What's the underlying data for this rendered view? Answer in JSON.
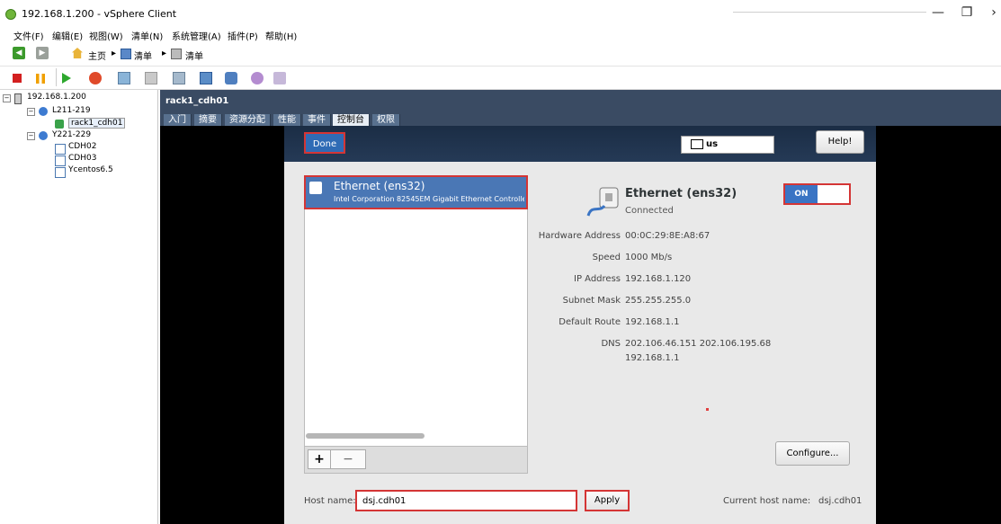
{
  "window": {
    "title": "192.168.1.200 - vSphere Client",
    "controls": {
      "minimize": "—",
      "restore": "❐",
      "more": "›"
    }
  },
  "menu": [
    "文件(F)",
    "编辑(E)",
    "视图(W)",
    "清单(N)",
    "系统管理(A)",
    "插件(P)",
    "帮助(H)"
  ],
  "nav": {
    "home": "主页",
    "inventory1": "清单",
    "inventory2": "清单"
  },
  "tree": {
    "host": "192.168.1.200",
    "group1": "L211-219",
    "vm_selected": "rack1_cdh01",
    "group2": "Y221-229",
    "vms": [
      "CDH02",
      "CDH03",
      "Ycentos6.5"
    ]
  },
  "vm": {
    "title": "rack1_cdh01",
    "tabs": [
      "入门",
      "摘要",
      "资源分配",
      "性能",
      "事件",
      "控制台",
      "权限"
    ],
    "active_tab": "控制台"
  },
  "installer": {
    "done_label": "Done",
    "keyboard_layout": "us",
    "help_label": "Help!"
  },
  "interfaces": [
    {
      "name": "Ethernet (ens32)",
      "description": "Intel Corporation 82545EM Gigabit Ethernet Controller"
    }
  ],
  "list_buttons": {
    "add": "+",
    "remove": "−"
  },
  "details": {
    "name": "Ethernet (ens32)",
    "status": "Connected",
    "toggle_label": "ON",
    "rows": [
      {
        "label": "Hardware Address",
        "value": "00:0C:29:8E:A8:67"
      },
      {
        "label": "Speed",
        "value": "1000 Mb/s"
      },
      {
        "label": "IP Address",
        "value": "192.168.1.120"
      },
      {
        "label": "Subnet Mask",
        "value": "255.255.255.0"
      },
      {
        "label": "Default Route",
        "value": "192.168.1.1"
      },
      {
        "label": "DNS",
        "value": "202.106.46.151 202.106.195.68",
        "value2": "192.168.1.1"
      }
    ],
    "configure_label": "Configure..."
  },
  "hostname": {
    "label": "Host name:",
    "value": "dsj.cdh01",
    "apply_label": "Apply",
    "current_label": "Current host name:",
    "current_value": "dsj.cdh01"
  },
  "colors": {
    "selection": "#4a77b5",
    "highlight_box": "#d43535",
    "header": "#3a4b63"
  }
}
